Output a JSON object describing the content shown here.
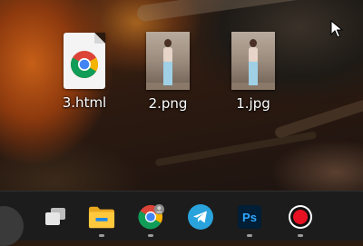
{
  "desktop": {
    "icons": [
      {
        "label": "3.html",
        "kind": "html-file",
        "icon": "chrome-icon"
      },
      {
        "label": "2.png",
        "kind": "image-file",
        "icon": "photo-thumbnail"
      },
      {
        "label": "1.jpg",
        "kind": "image-file",
        "icon": "photo-thumbnail"
      }
    ]
  },
  "taskbar": {
    "apps": [
      {
        "name": "start",
        "icon": "start-button"
      },
      {
        "name": "task-view",
        "icon": "task-view-icon"
      },
      {
        "name": "file-explorer",
        "icon": "folder-icon"
      },
      {
        "name": "chrome",
        "icon": "chrome-icon"
      },
      {
        "name": "telegram",
        "icon": "telegram-icon"
      },
      {
        "name": "photoshop",
        "icon": "photoshop-icon",
        "label": "Ps"
      },
      {
        "name": "screen-recorder",
        "icon": "record-icon"
      }
    ]
  },
  "colors": {
    "taskbar_bg": "#1c1c1c",
    "telegram": "#2aa3dc",
    "photoshop_bg": "#001e36",
    "photoshop_text": "#31a8ff",
    "record": "#e81123"
  }
}
